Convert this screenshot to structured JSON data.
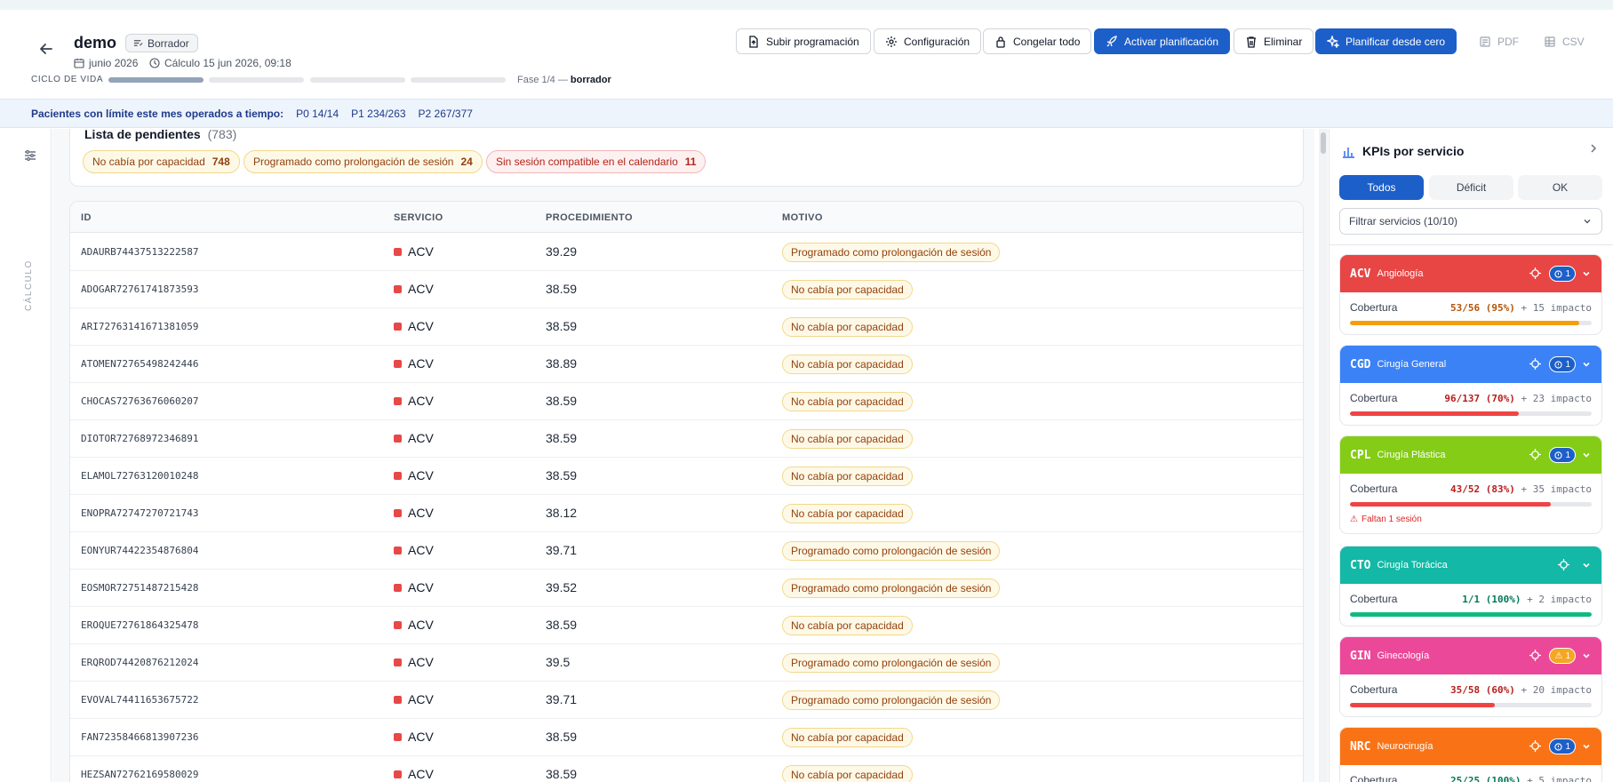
{
  "header": {
    "title": "demo",
    "status_badge": "Borrador",
    "month": "junio 2026",
    "calc_time": "Cálculo 15 jun 2026, 09:18",
    "lifecycle_label": "CICLO DE VIDA",
    "phase_prefix": "Fase 1/4 —",
    "phase_name": "borrador",
    "phase_progress": 0.25,
    "buttons": {
      "upload": "Subir programación",
      "config": "Configuración",
      "freeze": "Congelar todo",
      "activate": "Activar planificación",
      "delete": "Eliminar",
      "plan_scratch": "Planificar desde cero",
      "pdf": "PDF",
      "csv": "CSV"
    }
  },
  "info_bar": {
    "lead": "Pacientes con límite este mes operados a tiempo:",
    "p0": "P0 14/14",
    "p1": "P1 234/263",
    "p2": "P2 267/377"
  },
  "rail": {
    "label": "CÁLCULO"
  },
  "pending": {
    "title": "Lista de pendientes",
    "count": "(783)",
    "chips": [
      {
        "label": "No cabía por capacidad",
        "count": "748"
      },
      {
        "label": "Programado como prolongación de sesión",
        "count": "24"
      },
      {
        "label": "Sin sesión compatible en el calendario",
        "count": "11"
      }
    ]
  },
  "table": {
    "headers": {
      "id": "ID",
      "service": "SERVICIO",
      "procedure": "PROCEDIMIENTO",
      "reason": "MOTIVO"
    },
    "rows": [
      {
        "id": "ADAURB74437513222587",
        "service": "ACV",
        "procedure": "39.29",
        "reason": "Programado como prolongación de sesión"
      },
      {
        "id": "ADOGAR72761741873593",
        "service": "ACV",
        "procedure": "38.59",
        "reason": "No cabía por capacidad"
      },
      {
        "id": "ARI72763141671381059",
        "service": "ACV",
        "procedure": "38.59",
        "reason": "No cabía por capacidad"
      },
      {
        "id": "ATOMEN72765498242446",
        "service": "ACV",
        "procedure": "38.89",
        "reason": "No cabía por capacidad"
      },
      {
        "id": "CHOCAS72763676060207",
        "service": "ACV",
        "procedure": "38.59",
        "reason": "No cabía por capacidad"
      },
      {
        "id": "DIOTOR72768972346891",
        "service": "ACV",
        "procedure": "38.59",
        "reason": "No cabía por capacidad"
      },
      {
        "id": "ELAMOL72763120010248",
        "service": "ACV",
        "procedure": "38.59",
        "reason": "No cabía por capacidad"
      },
      {
        "id": "ENOPRA72747270721743",
        "service": "ACV",
        "procedure": "38.12",
        "reason": "No cabía por capacidad"
      },
      {
        "id": "EONYUR74422354876804",
        "service": "ACV",
        "procedure": "39.71",
        "reason": "Programado como prolongación de sesión"
      },
      {
        "id": "EOSMOR72751487215428",
        "service": "ACV",
        "procedure": "39.52",
        "reason": "Programado como prolongación de sesión"
      },
      {
        "id": "EROQUE72761864325478",
        "service": "ACV",
        "procedure": "38.59",
        "reason": "No cabía por capacidad"
      },
      {
        "id": "ERQROD74420876212024",
        "service": "ACV",
        "procedure": "39.5",
        "reason": "Programado como prolongación de sesión"
      },
      {
        "id": "EVOVAL74411653675722",
        "service": "ACV",
        "procedure": "39.71",
        "reason": "Programado como prolongación de sesión"
      },
      {
        "id": "FAN72358466813907236",
        "service": "ACV",
        "procedure": "38.59",
        "reason": "No cabía por capacidad"
      },
      {
        "id": "HEZSAN72762169580029",
        "service": "ACV",
        "procedure": "38.59",
        "reason": "No cabía por capacidad"
      }
    ]
  },
  "kpi_panel": {
    "title": "KPIs por servicio",
    "tabs": [
      "Todos",
      "Déficit",
      "OK"
    ],
    "filter": "Filtrar servicios (10/10)",
    "coverage_label": "Cobertura",
    "services": [
      {
        "code": "ACV",
        "name": "Angiología",
        "color": "#e84545",
        "pill": "1",
        "pill_type": "info",
        "coverage": "53/56 (95%)",
        "impact": "+ 15 impacto",
        "ratio": 0.95,
        "bar_color": "#f59e0b",
        "value_color": "#b45309",
        "warning": ""
      },
      {
        "code": "CGD",
        "name": "Cirugía General",
        "color": "#3b82f6",
        "pill": "1",
        "pill_type": "info",
        "coverage": "96/137 (70%)",
        "impact": "+ 23 impacto",
        "ratio": 0.7,
        "bar_color": "#ef4444",
        "value_color": "#b91c1c",
        "warning": ""
      },
      {
        "code": "CPL",
        "name": "Cirugía Plástica",
        "color": "#84cc16",
        "pill": "1",
        "pill_type": "info",
        "coverage": "43/52 (83%)",
        "impact": "+ 35 impacto",
        "ratio": 0.83,
        "bar_color": "#ef4444",
        "value_color": "#b91c1c",
        "warning": "Faltan 1 sesión"
      },
      {
        "code": "CTO",
        "name": "Cirugía Torácica",
        "color": "#14b8a6",
        "pill": "",
        "pill_type": "none",
        "coverage": "1/1 (100%)",
        "impact": "+ 2 impacto",
        "ratio": 1.0,
        "bar_color": "#10b981",
        "value_color": "#047857",
        "warning": ""
      },
      {
        "code": "GIN",
        "name": "Ginecología",
        "color": "#ec4899",
        "pill": "1",
        "pill_type": "warn",
        "coverage": "35/58 (60%)",
        "impact": "+ 20 impacto",
        "ratio": 0.6,
        "bar_color": "#ef4444",
        "value_color": "#b91c1c",
        "warning": ""
      },
      {
        "code": "NRC",
        "name": "Neurocirugía",
        "color": "#f97316",
        "pill": "1",
        "pill_type": "info",
        "coverage": "25/25 (100%)",
        "impact": "+ 5 impacto",
        "ratio": 1.0,
        "bar_color": "#10b981",
        "value_color": "#047857",
        "warning": ""
      }
    ]
  }
}
